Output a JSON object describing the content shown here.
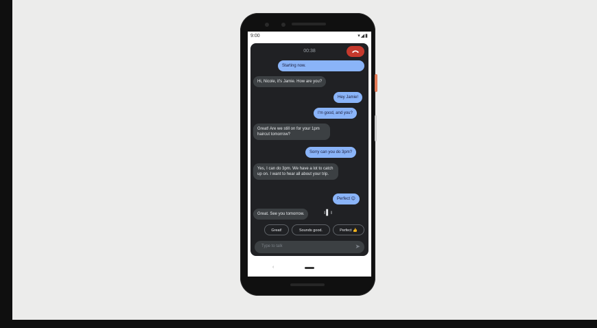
{
  "status_bar": {
    "time": "9:00",
    "icons": "▾◢▮"
  },
  "call": {
    "timer": "00:38"
  },
  "messages": [
    {
      "from": "me",
      "text": "Starting now."
    },
    {
      "from": "them",
      "text": "Hi, Nicole, it's Jamie. How are you?"
    },
    {
      "from": "me",
      "text": "Hey Jamie!"
    },
    {
      "from": "me",
      "text": "I'm good, and you?"
    },
    {
      "from": "them",
      "text": "Great! Are we still on for your 1pm haircut tomorrow?"
    },
    {
      "from": "me",
      "text": "Sorry can you do 3pm?"
    },
    {
      "from": "them",
      "text": "Yes, I can do 3pm. We have a lot to catch up on. I want to hear all about your trip."
    },
    {
      "from": "me",
      "text": "Perfect 😊"
    },
    {
      "from": "them",
      "text": "Great. See you tomorrow."
    }
  ],
  "quick_replies": [
    "Great!",
    "Sounds good.",
    "Perfect 👍"
  ],
  "compose": {
    "placeholder": "Type to talk"
  },
  "colors": {
    "bubble_me": "#8ab4f8",
    "bubble_them": "#3c4043",
    "hangup": "#c5392d",
    "panel": "#202124"
  },
  "icons": {
    "hangup": "phone-hangup-icon",
    "voice": "voice-activity-icon",
    "send": "send-icon"
  }
}
